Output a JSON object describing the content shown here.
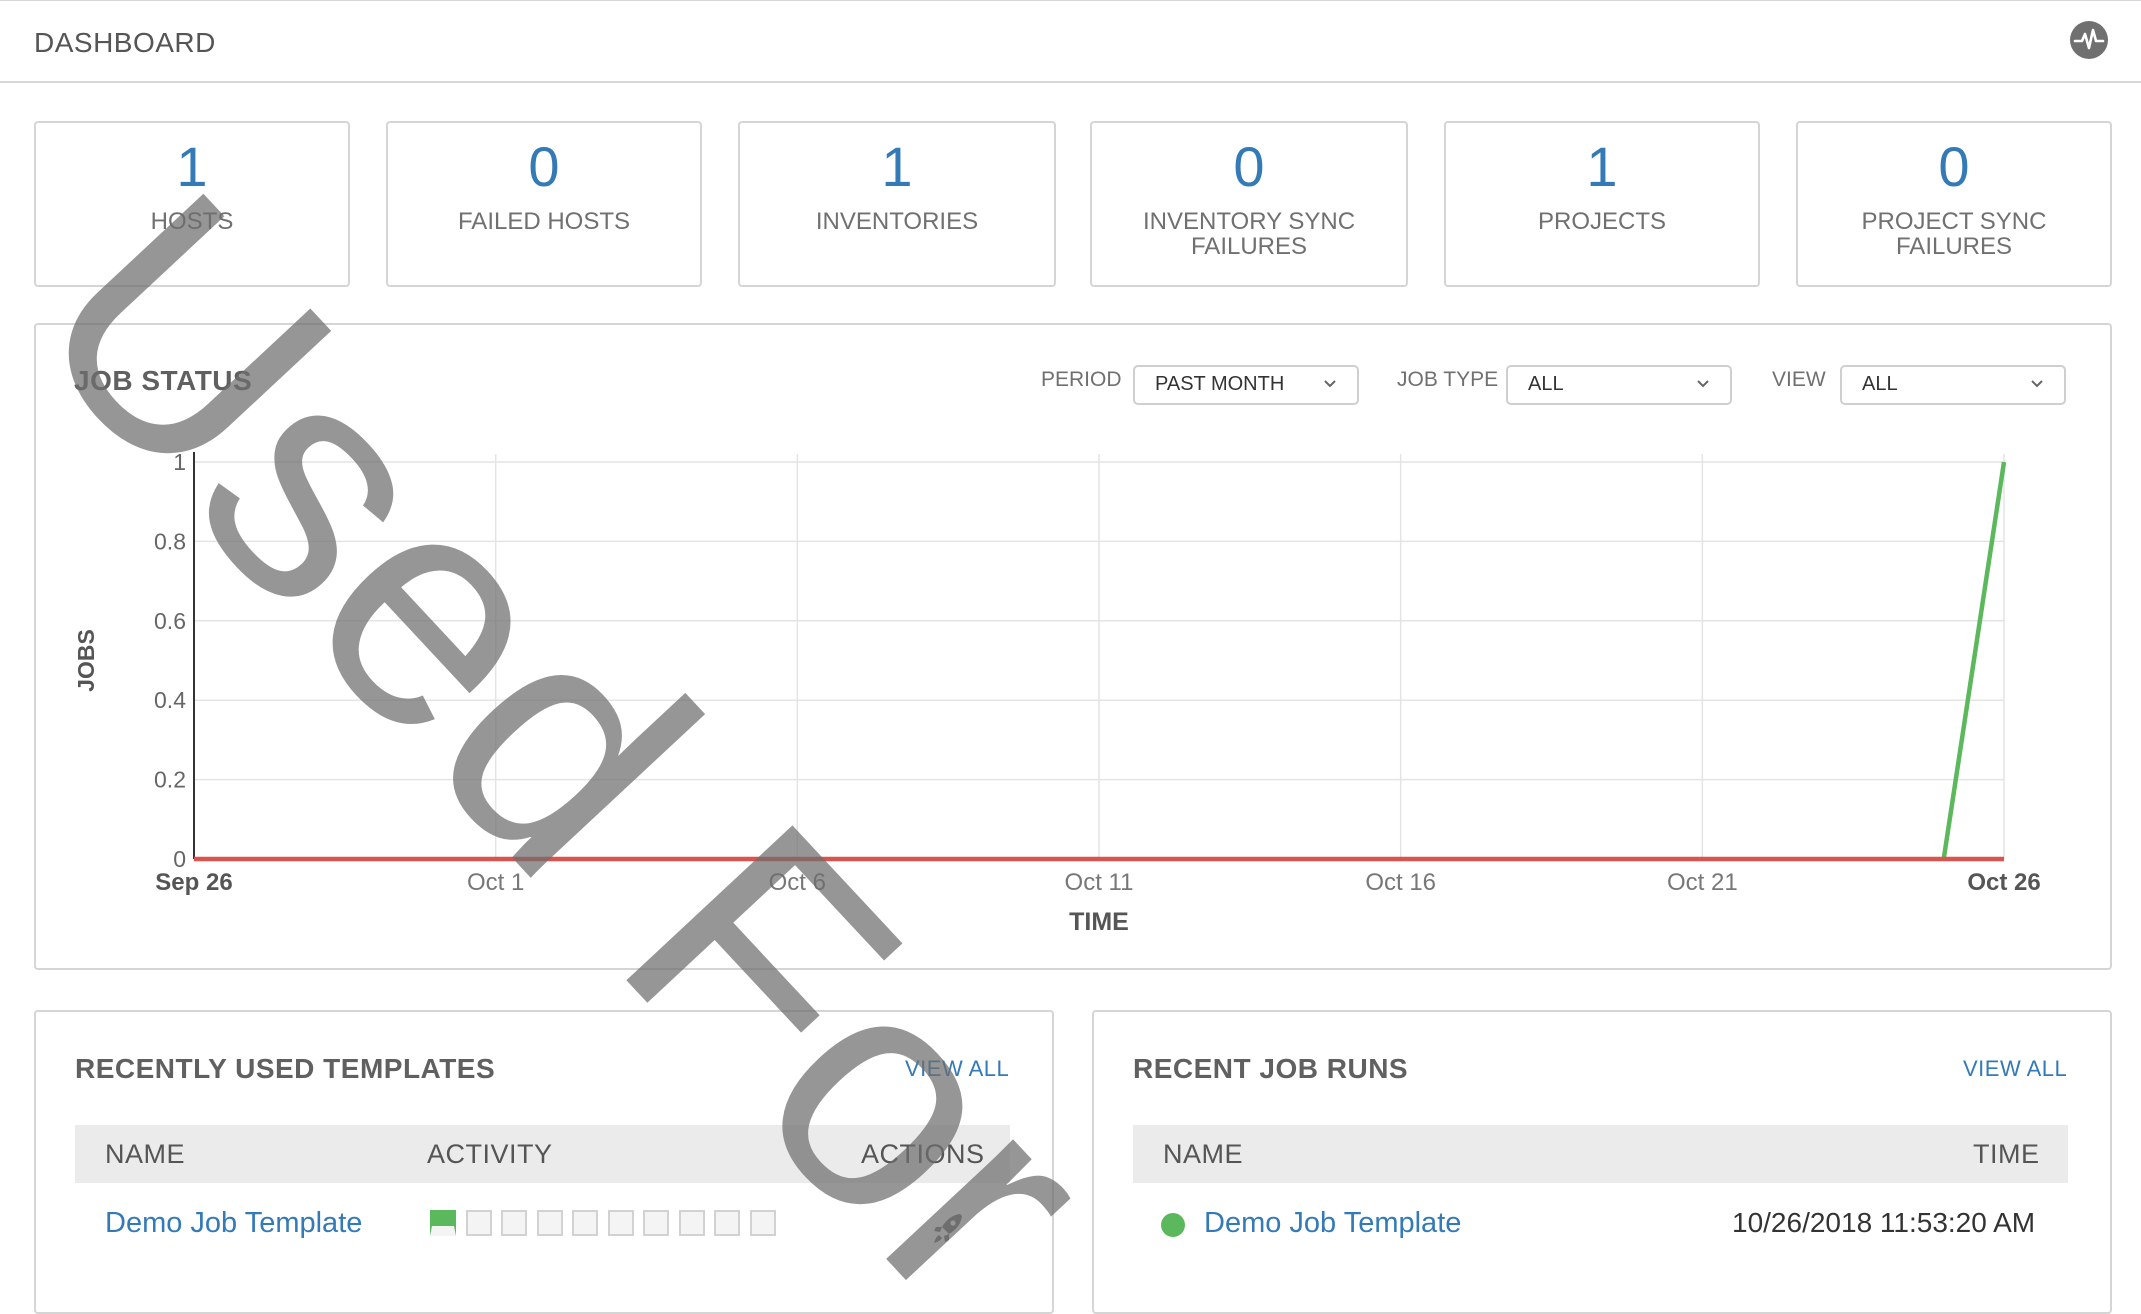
{
  "header": {
    "title": "DASHBOARD",
    "icon": "activity-stream-icon"
  },
  "counts": [
    {
      "count": "1",
      "label": "HOSTS"
    },
    {
      "count": "0",
      "label": "FAILED HOSTS"
    },
    {
      "count": "1",
      "label": "INVENTORIES"
    },
    {
      "count": "0",
      "label": "INVENTORY SYNC FAILURES"
    },
    {
      "count": "1",
      "label": "PROJECTS"
    },
    {
      "count": "0",
      "label": "PROJECT SYNC FAILURES"
    }
  ],
  "job_status": {
    "title": "JOB STATUS",
    "period_label": "PERIOD",
    "period_value": "PAST MONTH",
    "job_type_label": "JOB TYPE",
    "job_type_value": "ALL",
    "view_label": "VIEW",
    "view_value": "ALL"
  },
  "chart_data": {
    "type": "line",
    "xlabel": "TIME",
    "ylabel": "JOBS",
    "ylim": [
      0,
      1
    ],
    "y_ticks": [
      "0",
      "0.2",
      "0.4",
      "0.6",
      "0.8",
      "1"
    ],
    "x_ticks": [
      "Sep 26",
      "Oct 1",
      "Oct 6",
      "Oct 11",
      "Oct 16",
      "Oct 21",
      "Oct 26"
    ],
    "xlim": [
      "2018-09-26",
      "2018-10-26"
    ],
    "grid": true,
    "series": [
      {
        "color": "#5cb85c",
        "points": [
          [
            "2018-10-25",
            0
          ],
          [
            "2018-10-26",
            1
          ]
        ]
      },
      {
        "color": "#d9534f",
        "points": [
          [
            "2018-09-26",
            0
          ],
          [
            "2018-10-26",
            0
          ]
        ]
      }
    ]
  },
  "templates_panel": {
    "title": "RECENTLY USED TEMPLATES",
    "view_all": "VIEW ALL",
    "columns": [
      "NAME",
      "ACTIVITY",
      "ACTIONS"
    ],
    "rows": [
      {
        "name": "Demo Job Template",
        "activity": [
          "success",
          "none",
          "none",
          "none",
          "none",
          "none",
          "none",
          "none",
          "none",
          "none"
        ],
        "action_icon": "rocket-launch-icon"
      }
    ]
  },
  "job_runs_panel": {
    "title": "RECENT JOB RUNS",
    "view_all": "VIEW ALL",
    "columns": [
      "NAME",
      "TIME"
    ],
    "rows": [
      {
        "status": "success",
        "status_color": "#5cb85c",
        "name": "Demo Job Template",
        "time": "10/26/2018 11:53:20 AM"
      }
    ]
  },
  "watermark": "Used For"
}
